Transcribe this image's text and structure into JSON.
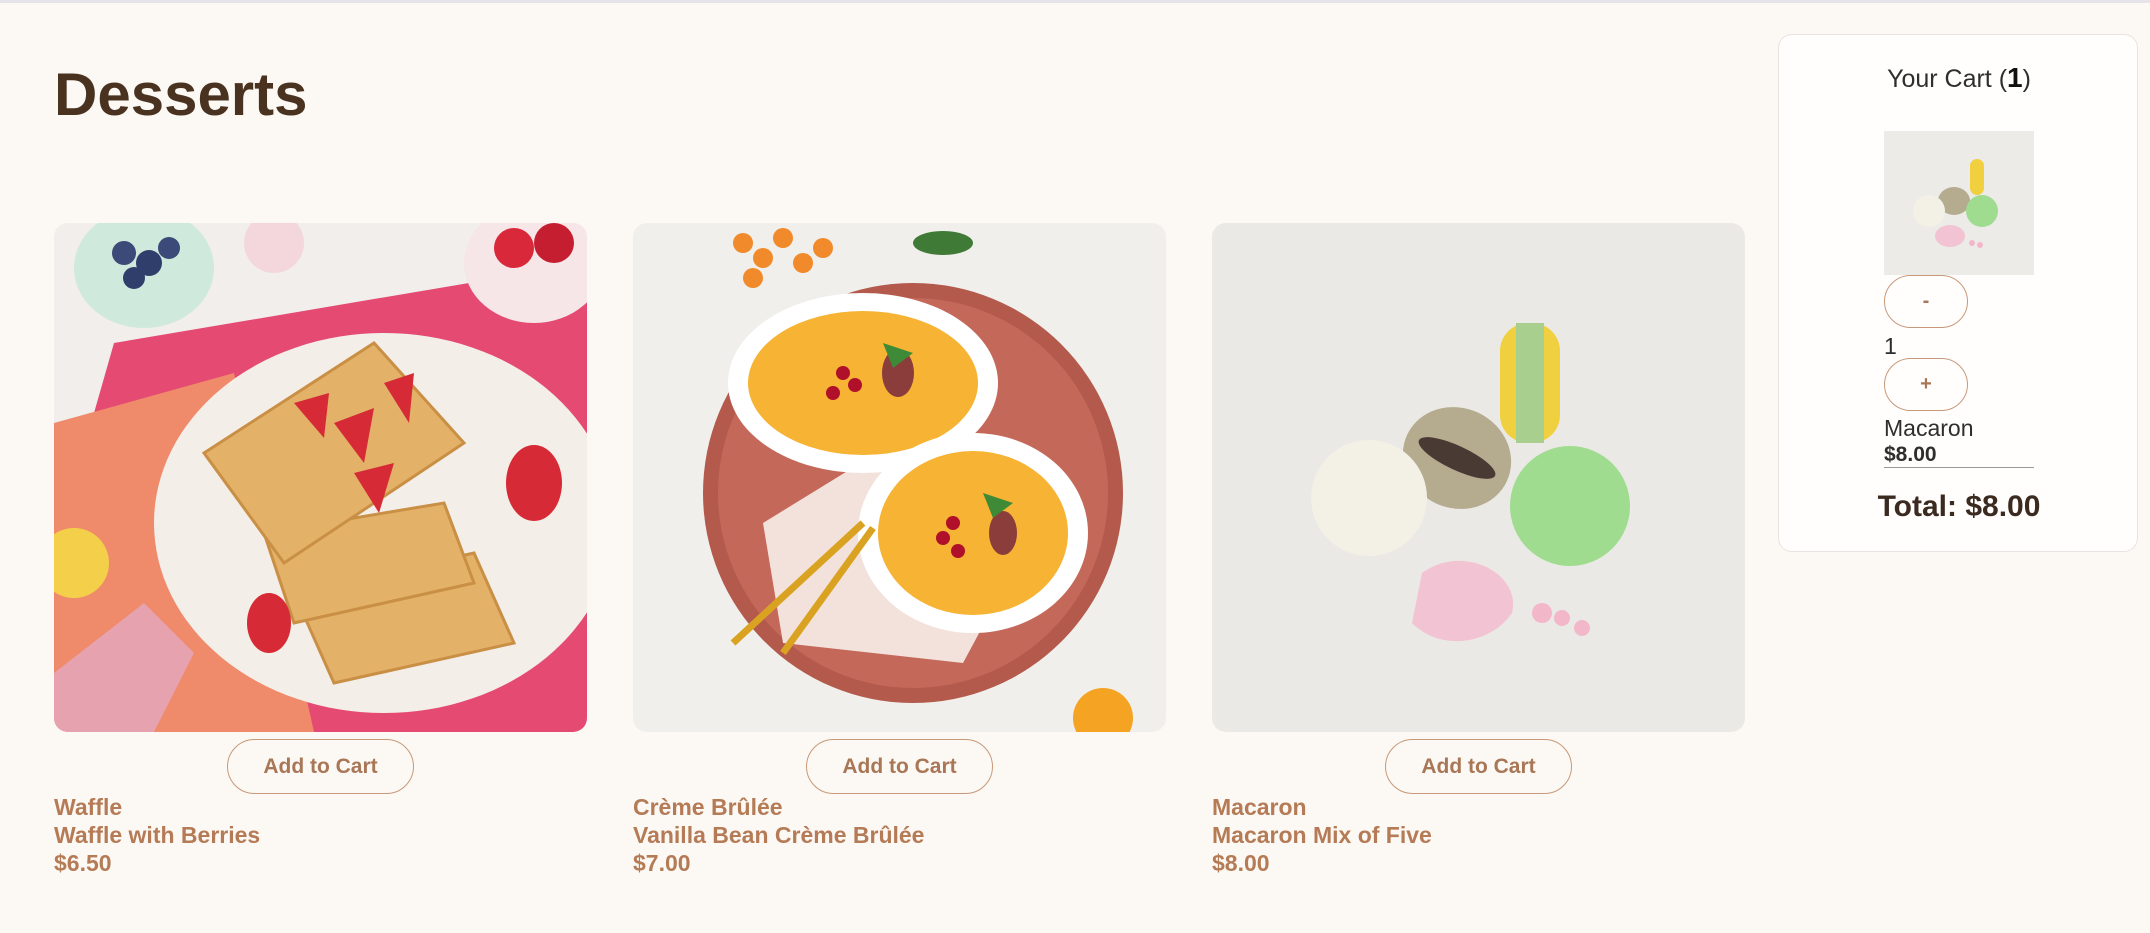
{
  "page": {
    "title": "Desserts"
  },
  "products": [
    {
      "category": "Waffle",
      "name": "Waffle with Berries",
      "price": "$6.50",
      "add_label": "Add to Cart"
    },
    {
      "category": "Crème Brûlée",
      "name": "Vanilla Bean Crème Brûlée",
      "price": "$7.00",
      "add_label": "Add to Cart"
    },
    {
      "category": "Macaron",
      "name": "Macaron Mix of Five",
      "price": "$8.00",
      "add_label": "Add to Cart"
    }
  ],
  "cart": {
    "title_prefix": "Your Cart (",
    "count": "1",
    "title_suffix": ")",
    "items": [
      {
        "name": "Macaron",
        "price": "$8.00",
        "quantity": "1",
        "decrement_label": "-",
        "increment_label": "+"
      }
    ],
    "total": "Total: $8.00"
  },
  "colors": {
    "background": "#fcf8f3",
    "accent": "#b57b56",
    "button_border": "#c7997a",
    "heading": "#4a3220"
  }
}
